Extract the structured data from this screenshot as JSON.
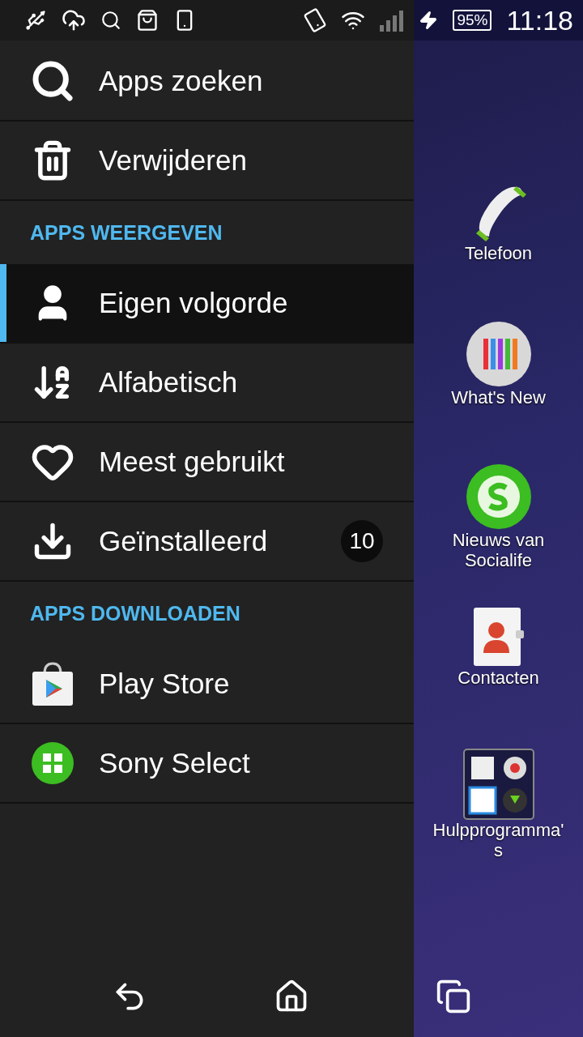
{
  "status_bar": {
    "battery": "95%",
    "time": "11:18"
  },
  "drawer": {
    "sections": [
      {
        "items": [
          {
            "label": "Apps zoeken"
          },
          {
            "label": "Verwijderen"
          }
        ]
      },
      {
        "header": "APPS WEERGEVEN",
        "items": [
          {
            "label": "Eigen volgorde",
            "selected": true
          },
          {
            "label": "Alfabetisch",
            "selected": false
          },
          {
            "label": "Meest gebruikt",
            "selected": false
          },
          {
            "label": "Geïnstalleerd",
            "selected": false,
            "badge": "10"
          }
        ]
      },
      {
        "header": "APPS DOWNLOADEN",
        "items": [
          {
            "label": "Play Store"
          },
          {
            "label": "Sony Select"
          }
        ]
      }
    ]
  },
  "home_apps": [
    {
      "label": "Telefoon"
    },
    {
      "label": "What's New"
    },
    {
      "label": "Nieuws van Socialife"
    },
    {
      "label": "Contacten"
    },
    {
      "label": "Hulpprogramma's"
    }
  ]
}
